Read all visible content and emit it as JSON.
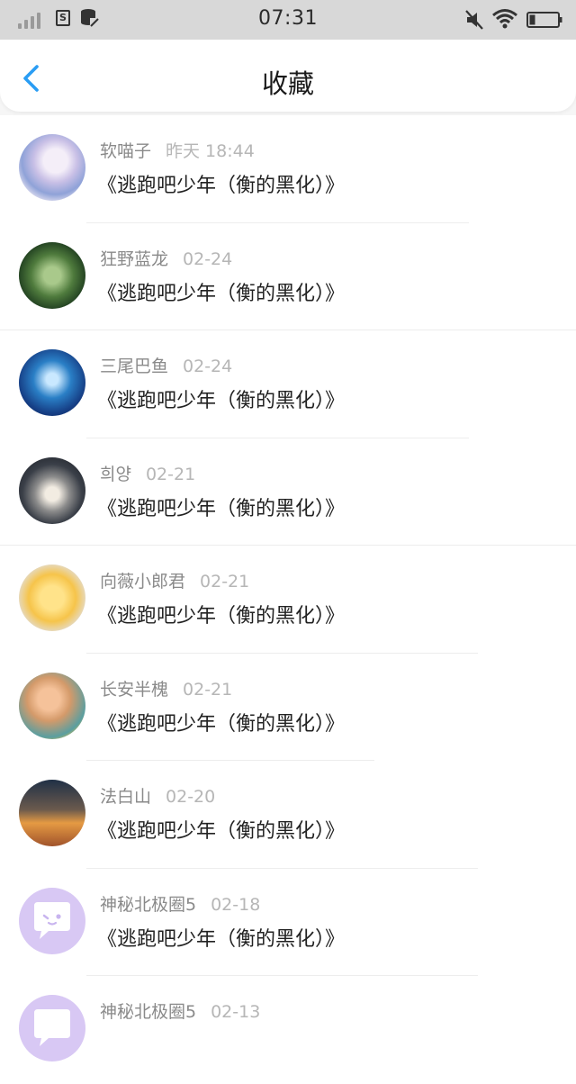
{
  "status_bar": {
    "time": "07:31",
    "sim_icon_label": "S",
    "icons": [
      "signal-icon",
      "sim-icon",
      "database-icon",
      "mute-icon",
      "wifi-icon",
      "battery-icon"
    ]
  },
  "header": {
    "title": "收藏",
    "back_icon": "chevron-left-icon",
    "accent_color": "#2a9df4"
  },
  "favorites": [
    {
      "user": "软喵子",
      "time": "昨天 18:44",
      "title": "《逃跑吧少年（衡的黑化）》",
      "avatar": "anime-girl-avatar"
    },
    {
      "user": "狂野蓝龙",
      "time": "02-24",
      "title": "《逃跑吧少年（衡的黑化）》",
      "avatar": "green-dragon-avatar"
    },
    {
      "user": "三尾巴鱼",
      "time": "02-24",
      "title": "《逃跑吧少年（衡的黑化）》",
      "avatar": "blue-hair-anime-avatar"
    },
    {
      "user": "희양",
      "time": "02-21",
      "title": "《逃跑吧少年（衡的黑化）》",
      "avatar": "hooded-boy-avatar"
    },
    {
      "user": "向薇小郎君",
      "time": "02-21",
      "title": "《逃跑吧少年（衡的黑化）》",
      "avatar": "blonde-anime-avatar"
    },
    {
      "user": "长安半槐",
      "time": "02-21",
      "title": "《逃跑吧少年（衡的黑化）》",
      "avatar": "child-photo-avatar"
    },
    {
      "user": "法白山",
      "time": "02-20",
      "title": "《逃跑吧少年（衡的黑化）》",
      "avatar": "sunset-pier-avatar"
    },
    {
      "user": "神秘北极圈5",
      "time": "02-18",
      "title": "《逃跑吧少年（衡的黑化）》",
      "avatar": "default-chat-avatar"
    },
    {
      "user": "神秘北极圈5",
      "time": "02-13",
      "title": "",
      "avatar": "default-chat-avatar"
    }
  ]
}
